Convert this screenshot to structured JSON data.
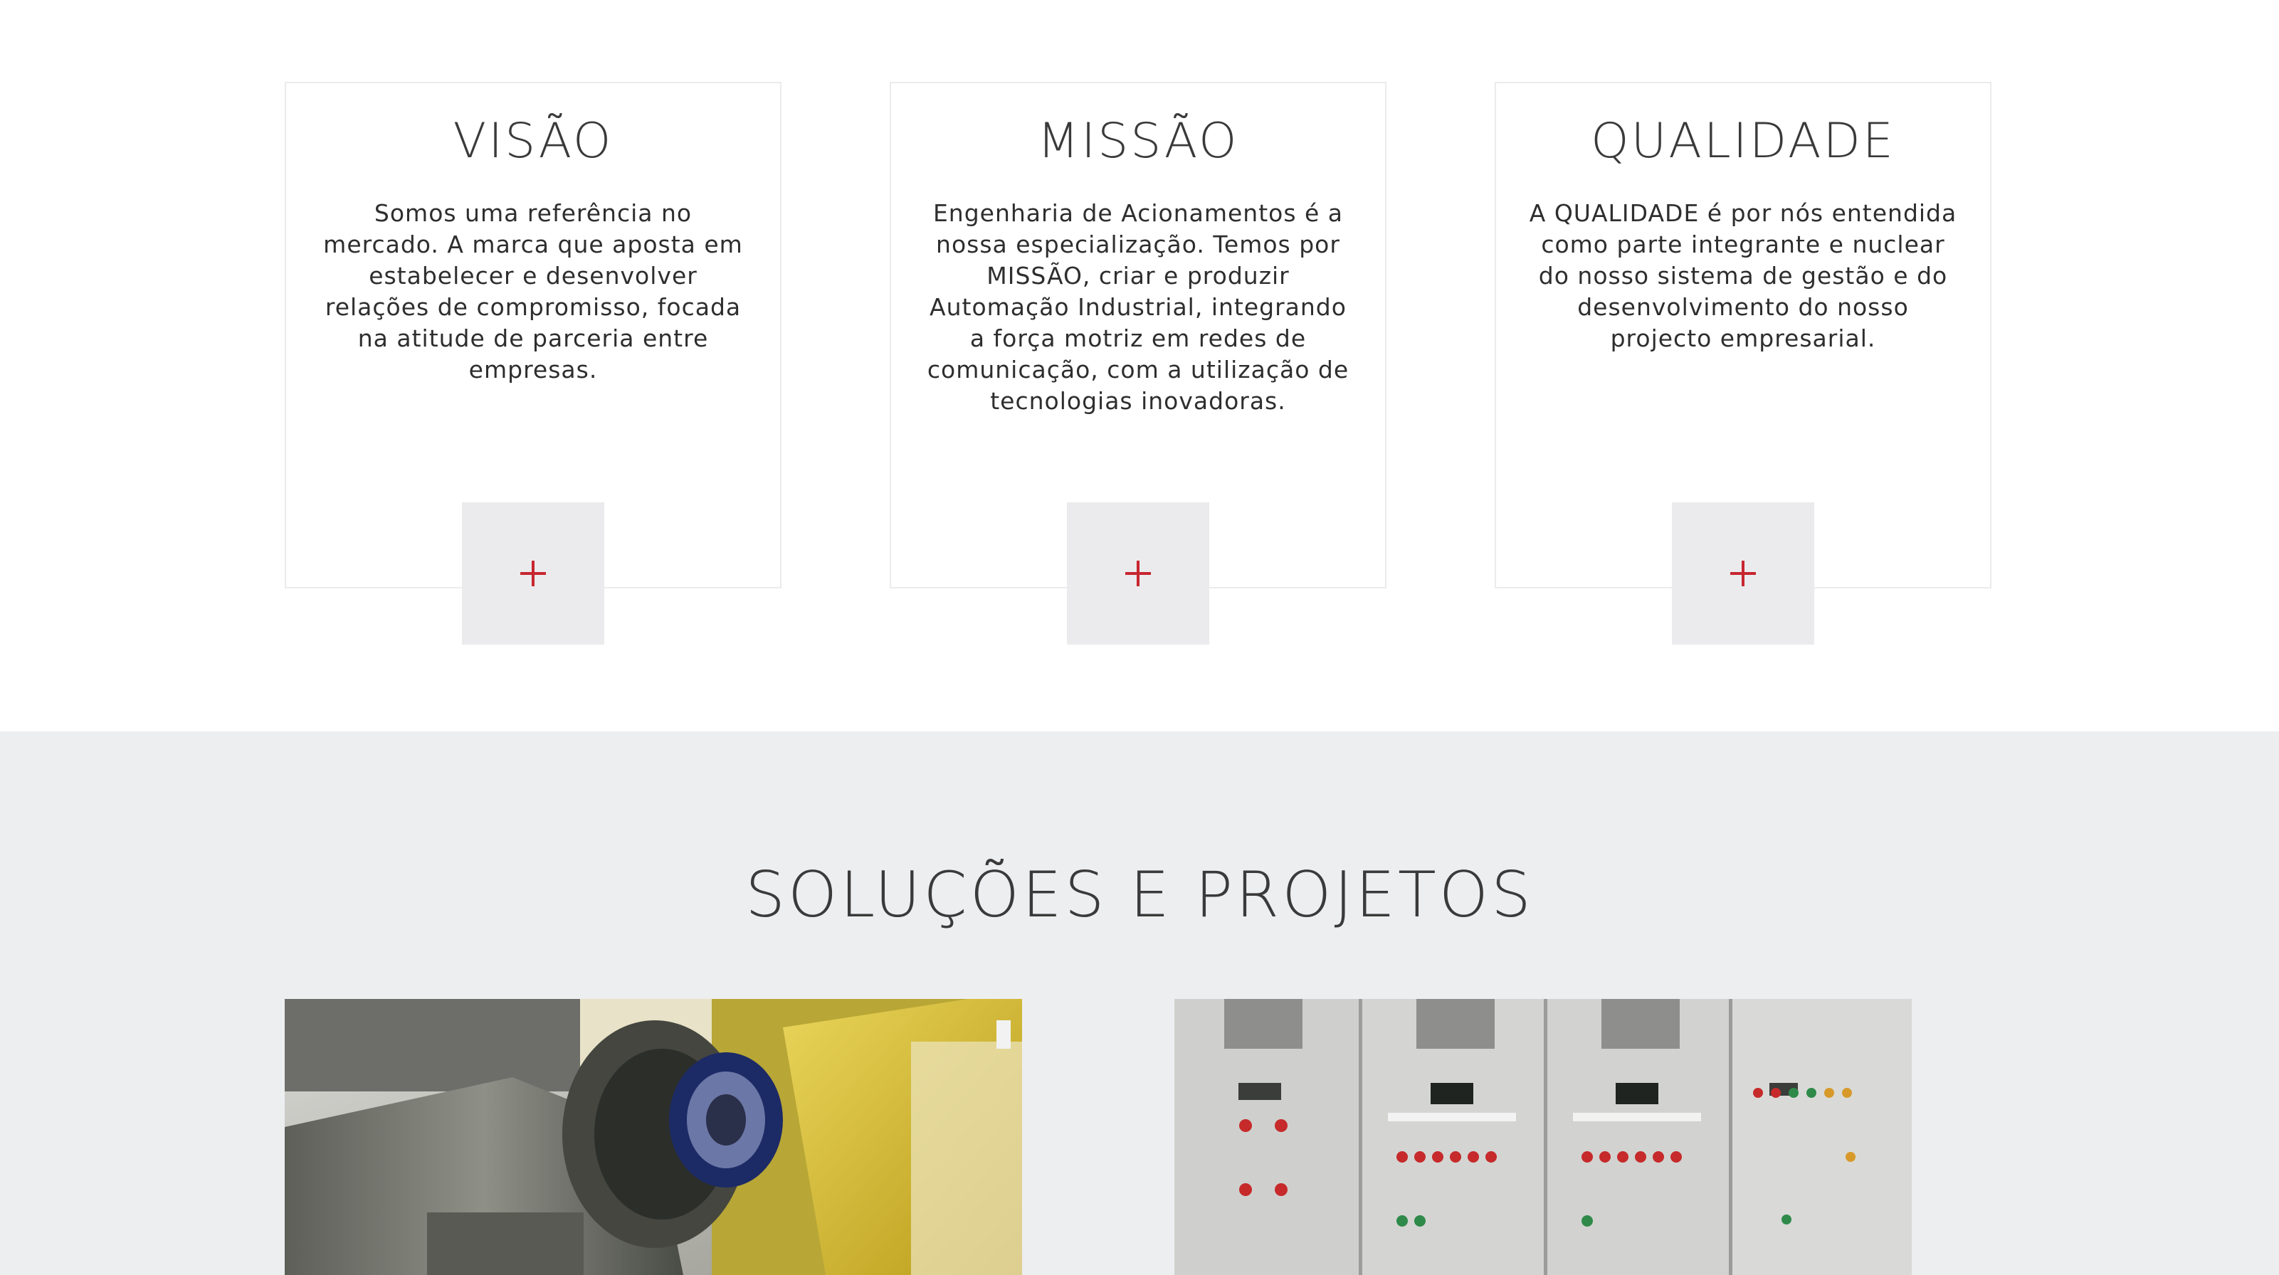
{
  "values_section": {
    "cards": [
      {
        "title": "VISÃO",
        "text": "Somos uma referência no mercado. A marca que aposta em estabelecer e desenvolver relações de compromisso, focada na atitude de parceria entre empresas."
      },
      {
        "title": "MISSÃO",
        "text": "Engenharia de Acionamentos é a nossa especialização. Temos por MISSÃO, criar e produzir Automação Industrial, integrando a força motriz em redes de comunicação, com a utilização de tecnologias inovadoras."
      },
      {
        "title": "QUALIDADE",
        "text": "A QUALIDADE é por nós entendida como parte integrante e nuclear do nosso sistema de gestão e do desenvolvimento do nosso projecto empresarial."
      }
    ],
    "more_button_icon": "plus-icon"
  },
  "solutions_section": {
    "title": "SOLUÇÕES E PROJETOS",
    "photos": [
      {
        "subject": "industrial-gearbox-machinery"
      },
      {
        "subject": "electrical-control-panels"
      }
    ]
  },
  "colors": {
    "accent": "#c7262f",
    "section_gray": "#edeef0",
    "button_gray": "#ebebed",
    "card_border": "#ebebed",
    "text": "#333333"
  }
}
